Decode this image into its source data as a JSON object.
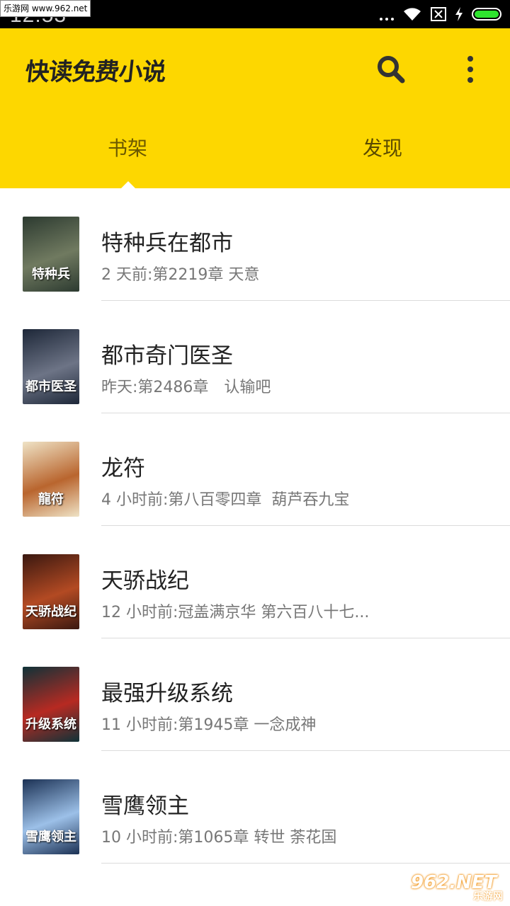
{
  "status_bar": {
    "time": "12:53",
    "watermark": "乐游网 www.962.net"
  },
  "app": {
    "title": "快读免费小说",
    "tabs": [
      {
        "label": "书架",
        "active": true
      },
      {
        "label": "发现",
        "active": false
      }
    ],
    "accent_color": "#FDD700"
  },
  "books": [
    {
      "title": "特种兵在都市",
      "info": "2 天前:第2219章 天意",
      "cover_text": "特种兵",
      "cover_colors": [
        "#2c3a30",
        "#707a60"
      ]
    },
    {
      "title": "都市奇门医圣",
      "info": "昨天:第2486章　认输吧",
      "cover_text": "都市医圣",
      "cover_colors": [
        "#1d2738",
        "#6d7486"
      ]
    },
    {
      "title": "龙符",
      "info": "4 小时前:第八百零四章  葫芦吞九宝",
      "cover_text": "龍符",
      "cover_colors": [
        "#efe3c6",
        "#b9652e"
      ]
    },
    {
      "title": "天骄战纪",
      "info": "12 小时前:冠盖满京华 第六百八十七...",
      "cover_text": "天骄战纪",
      "cover_colors": [
        "#3a1810",
        "#b34a23"
      ]
    },
    {
      "title": "最强升级系统",
      "info": "11 小时前:第1945章 一念成神",
      "cover_text": "升级系统",
      "cover_colors": [
        "#0f3238",
        "#b72a22"
      ]
    },
    {
      "title": "雪鹰领主",
      "info": "10 小时前:第1065章 转世 荼花国",
      "cover_text": "雪鹰领主",
      "cover_colors": [
        "#1b3154",
        "#9cc0e8"
      ]
    }
  ],
  "watermark_bottom": {
    "logo": "962.NET",
    "sub": "乐游网"
  }
}
